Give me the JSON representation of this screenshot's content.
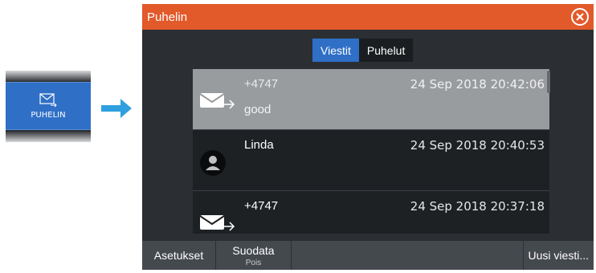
{
  "sidebar_tile": {
    "label": "PUHELIN",
    "icon": "envelope-icon"
  },
  "dialog": {
    "title": "Puhelin",
    "tabs": [
      {
        "label": "Viestit",
        "active": true
      },
      {
        "label": "Puhelut",
        "active": false
      }
    ],
    "messages": [
      {
        "sender": "+4747",
        "timestamp": "24 Sep 2018 20:42:06",
        "preview": "good",
        "icon": "message-envelope-icon",
        "selected": true
      },
      {
        "sender": "Linda",
        "timestamp": "24 Sep 2018 20:40:53",
        "preview": "",
        "icon": "contact-avatar-icon",
        "selected": false
      },
      {
        "sender": "+4747",
        "timestamp": "24 Sep 2018 20:37:18",
        "preview": "",
        "icon": "message-envelope-icon",
        "selected": false
      }
    ],
    "bottom_bar": {
      "settings": "Asetukset",
      "filter_label": "Suodata",
      "filter_value": "Pois",
      "new_message": "Uusi viesti..."
    }
  },
  "colors": {
    "accent_orange": "#e2592a",
    "accent_blue": "#2f6fc6",
    "background_dark": "#2b2f33"
  }
}
